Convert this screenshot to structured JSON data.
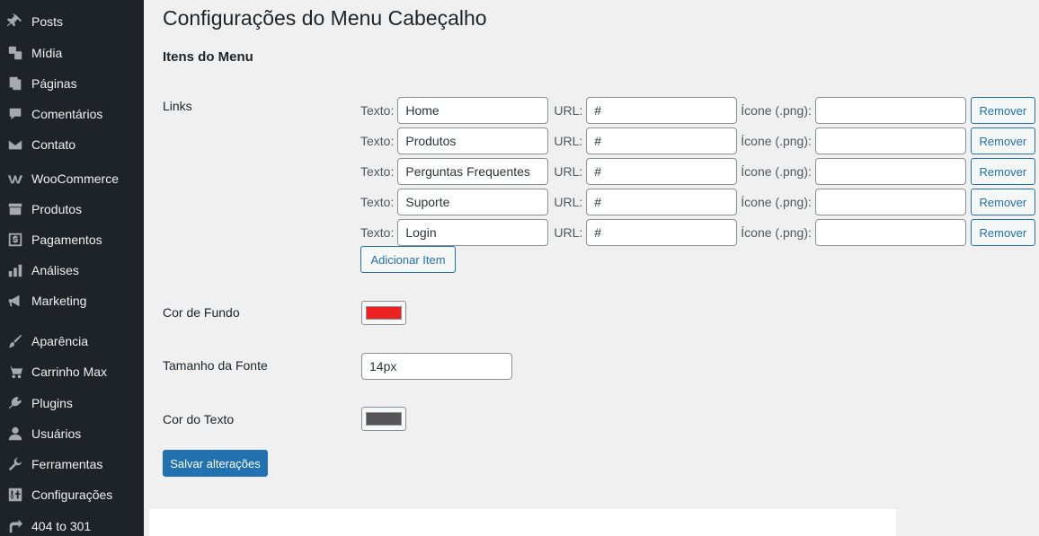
{
  "sidebar": {
    "items": [
      {
        "label": "Posts",
        "icon": "pin-icon"
      },
      {
        "label": "Mídia",
        "icon": "media-icon"
      },
      {
        "label": "Páginas",
        "icon": "pages-icon"
      },
      {
        "label": "Comentários",
        "icon": "comment-icon"
      },
      {
        "label": "Contato",
        "icon": "envelope-icon"
      },
      {
        "label": "WooCommerce",
        "icon": "woocommerce-icon"
      },
      {
        "label": "Produtos",
        "icon": "archive-icon"
      },
      {
        "label": "Pagamentos",
        "icon": "dollar-icon"
      },
      {
        "label": "Análises",
        "icon": "bar-chart-icon"
      },
      {
        "label": "Marketing",
        "icon": "megaphone-icon"
      },
      {
        "label": "Aparência",
        "icon": "paintbrush-icon"
      },
      {
        "label": "Carrinho Max",
        "icon": "cart-icon"
      },
      {
        "label": "Plugins",
        "icon": "plug-icon"
      },
      {
        "label": "Usuários",
        "icon": "user-icon"
      },
      {
        "label": "Ferramentas",
        "icon": "wrench-icon"
      },
      {
        "label": "Configurações",
        "icon": "settings-icon"
      },
      {
        "label": "404 to 301",
        "icon": "redirect-icon"
      }
    ]
  },
  "page": {
    "title": "Configurações do Menu Cabeçalho",
    "section_title": "Itens do Menu"
  },
  "links": {
    "label": "Links",
    "text_label": "Texto:",
    "url_label": "URL:",
    "icon_label": "Ícone (.png):",
    "remove_label": "Remover",
    "add_label": "Adicionar Item",
    "rows": [
      {
        "text": "Home",
        "url": "#",
        "icon": ""
      },
      {
        "text": "Produtos",
        "url": "#",
        "icon": ""
      },
      {
        "text": "Perguntas Frequentes",
        "url": "#",
        "icon": ""
      },
      {
        "text": "Suporte",
        "url": "#",
        "icon": ""
      },
      {
        "text": "Login",
        "url": "#",
        "icon": ""
      }
    ]
  },
  "settings": {
    "bg_color_label": "Cor de Fundo",
    "bg_color_value": "#ee2222",
    "font_size_label": "Tamanho da Fonte",
    "font_size_value": "14px",
    "text_color_label": "Cor do Texto",
    "text_color_value": "#555555"
  },
  "save_label": "Salvar alterações"
}
